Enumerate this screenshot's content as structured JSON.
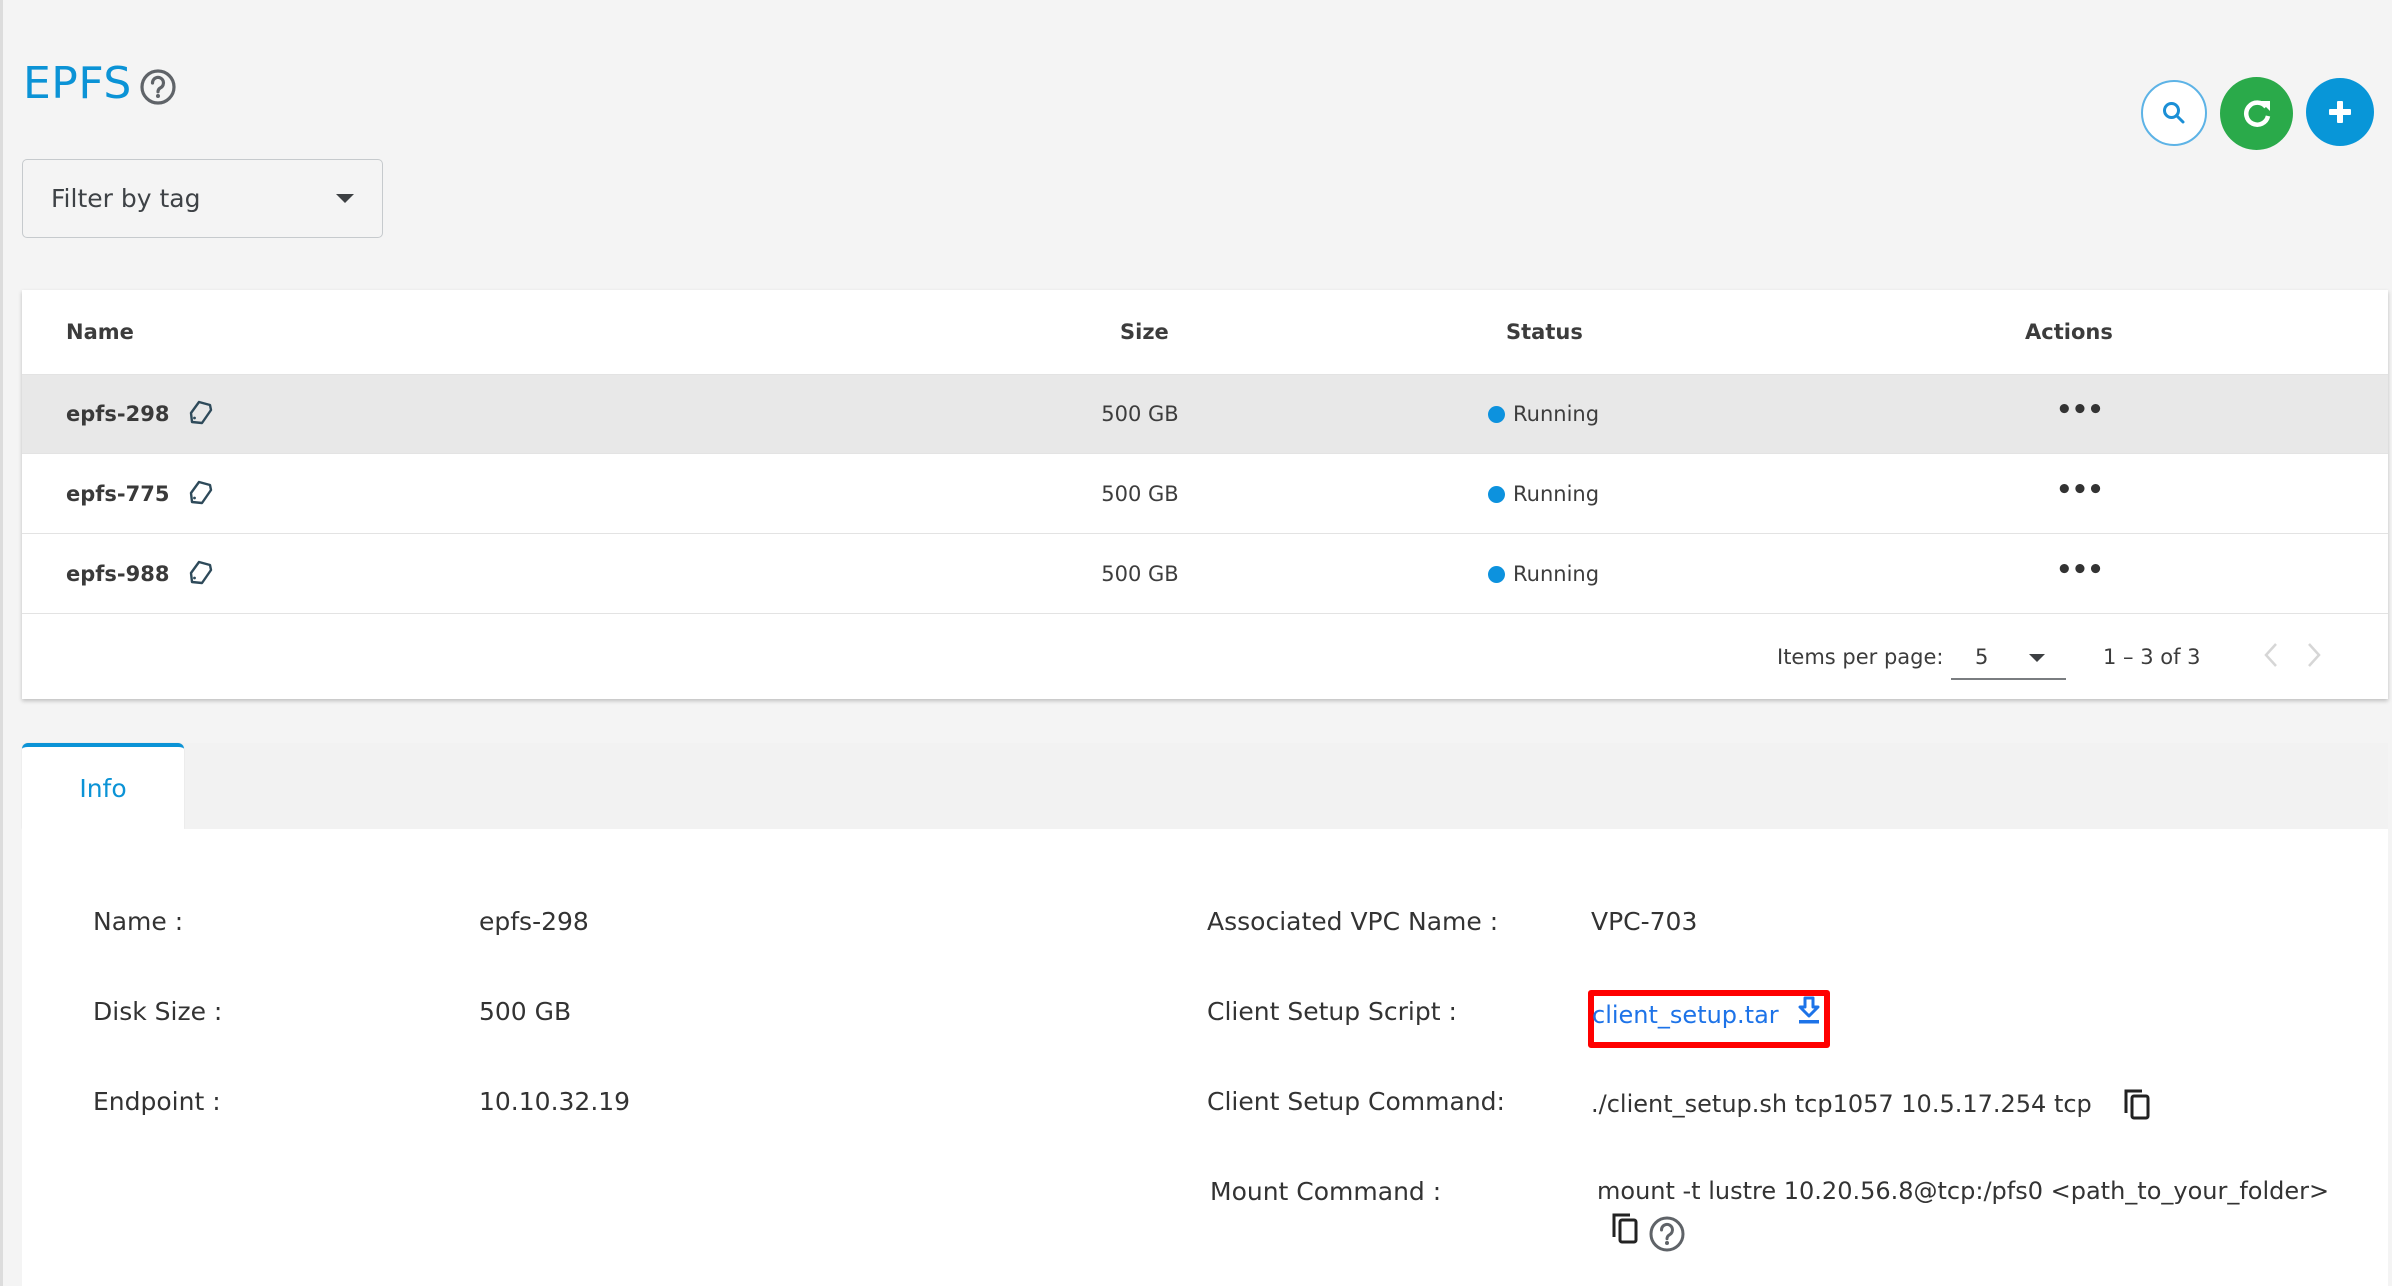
{
  "page": {
    "title": "EPFS",
    "help_icon": "help-circle-icon"
  },
  "filter": {
    "placeholder": "Filter by tag",
    "icon": "caret-down-icon"
  },
  "toolbar": {
    "search_icon": "search-icon",
    "refresh_icon": "refresh-icon",
    "add_icon": "plus-icon",
    "colors": {
      "search_border": "#5db3e6",
      "refresh_bg": "#2aaa4a",
      "add_bg": "#0896d8"
    }
  },
  "table": {
    "columns": [
      "Name",
      "Size",
      "Status",
      "Actions"
    ],
    "rows": [
      {
        "name": "epfs-298",
        "size": "500 GB",
        "status": "Running",
        "actions": "•••",
        "selected": true
      },
      {
        "name": "epfs-775",
        "size": "500 GB",
        "status": "Running",
        "actions": "•••",
        "selected": false
      },
      {
        "name": "epfs-988",
        "size": "500 GB",
        "status": "Running",
        "actions": "•••",
        "selected": false
      }
    ],
    "status_color": "#0d92de"
  },
  "paginator": {
    "items_per_page_label": "Items per page:",
    "items_per_page_value": "5",
    "range_label": "1 – 3 of 3"
  },
  "details": {
    "tabs": [
      {
        "label": "Info",
        "active": true
      }
    ],
    "left": [
      {
        "label": "Name :",
        "value": "epfs-298"
      },
      {
        "label": "Disk Size :",
        "value": "500 GB"
      },
      {
        "label": "Endpoint :",
        "value": "10.10.32.19"
      }
    ],
    "right": [
      {
        "label": "Associated VPC Name :",
        "value": "VPC-703"
      },
      {
        "label": "Client Setup Script :",
        "value": "client_setup.tar"
      },
      {
        "label": "Client Setup Command:",
        "value": "./client_setup.sh tcp1057 10.5.17.254 tcp"
      },
      {
        "label": "Mount Command :",
        "value": "mount -t lustre 10.20.56.8@tcp:/pfs0 <path_to_your_folder>"
      }
    ],
    "highlight_color": "#ff0000",
    "link_color": "#1d73e8"
  }
}
